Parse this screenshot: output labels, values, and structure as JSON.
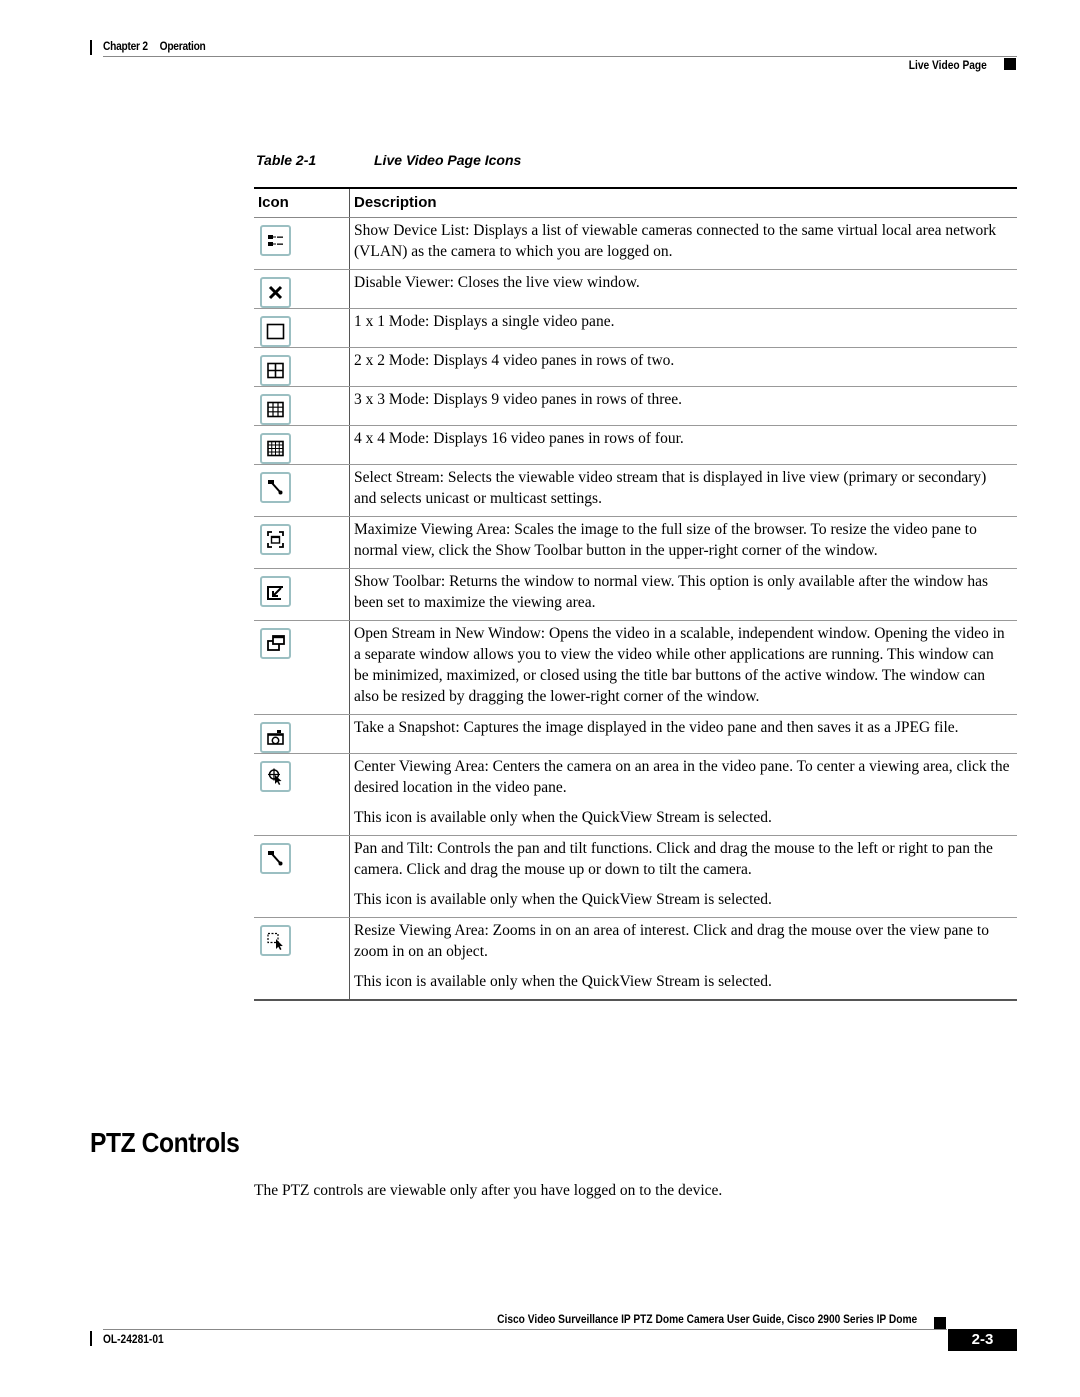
{
  "header": {
    "chapter_label": "Chapter 2",
    "chapter_title": "Operation",
    "section": "Live Video Page"
  },
  "table": {
    "caption_number": "Table 2-1",
    "caption_title": "Live Video Page Icons",
    "columns": [
      "Icon",
      "Description"
    ],
    "rows": [
      {
        "icon": "device-list-icon",
        "desc": [
          "Show Device List: Displays a list of viewable cameras connected to the same virtual local area network (VLAN) as the camera to which you are logged on."
        ]
      },
      {
        "icon": "close-icon",
        "desc": [
          "Disable Viewer: Closes the live view window."
        ]
      },
      {
        "icon": "layout-1x1-icon",
        "desc": [
          "1 x 1 Mode: Displays a single video pane."
        ]
      },
      {
        "icon": "layout-2x2-icon",
        "desc": [
          "2 x 2 Mode: Displays 4 video panes in rows of two."
        ]
      },
      {
        "icon": "layout-3x3-icon",
        "desc": [
          "3 x 3 Mode: Displays 9 video panes in rows of three."
        ]
      },
      {
        "icon": "layout-4x4-icon",
        "desc": [
          "4 x 4 Mode: Displays 16 video panes in rows of four."
        ]
      },
      {
        "icon": "select-stream-icon",
        "desc": [
          "Select Stream: Selects the viewable video stream that is displayed in live view (primary or secondary) and selects unicast or multicast settings."
        ]
      },
      {
        "icon": "maximize-icon",
        "desc": [
          "Maximize Viewing Area: Scales the image to the full size of the browser. To resize the video pane to normal view, click the Show Toolbar button in the upper-right corner of the window."
        ]
      },
      {
        "icon": "show-toolbar-icon",
        "desc": [
          "Show Toolbar: Returns the window to normal view. This option is only available after the window has been set to maximize the viewing area."
        ]
      },
      {
        "icon": "new-window-icon",
        "desc": [
          "Open Stream in New Window: Opens the video in a scalable, independent window. Opening the video in a separate window allows you to view the video while other applications are running. This window can be minimized, maximized, or closed using the title bar buttons of the active window. The window can also be resized by dragging the lower-right corner of the window."
        ]
      },
      {
        "icon": "snapshot-icon",
        "desc": [
          "Take a Snapshot: Captures the image displayed in the video pane and then saves it as a JPEG file."
        ]
      },
      {
        "icon": "center-view-icon",
        "desc": [
          "Center Viewing Area: Centers the camera on an area in the video pane. To center a viewing area, click the desired location in the video pane.",
          "This icon is available only when the QuickView Stream is selected."
        ]
      },
      {
        "icon": "pan-tilt-icon",
        "desc": [
          "Pan and Tilt: Controls the pan and tilt functions. Click and drag the mouse to the left or right to pan the camera. Click and drag the mouse up or down to tilt the camera.",
          "This icon is available only when the QuickView Stream is selected."
        ]
      },
      {
        "icon": "resize-view-icon",
        "desc": [
          "Resize Viewing Area: Zooms in on an area of interest. Click and drag the mouse over the view pane to zoom in on an object.",
          "This icon is available only when the QuickView Stream is selected."
        ]
      }
    ]
  },
  "section": {
    "heading": "PTZ Controls",
    "body": "The PTZ controls are viewable only after you have logged on to the device."
  },
  "footer": {
    "guide_title": "Cisco Video Surveillance IP PTZ Dome Camera User Guide, Cisco 2900 Series IP Dome",
    "doc_number": "OL-24281-01",
    "page_number": "2-3"
  },
  "colors": {
    "icon_border": "#9bbfc2",
    "text": "#000000"
  }
}
